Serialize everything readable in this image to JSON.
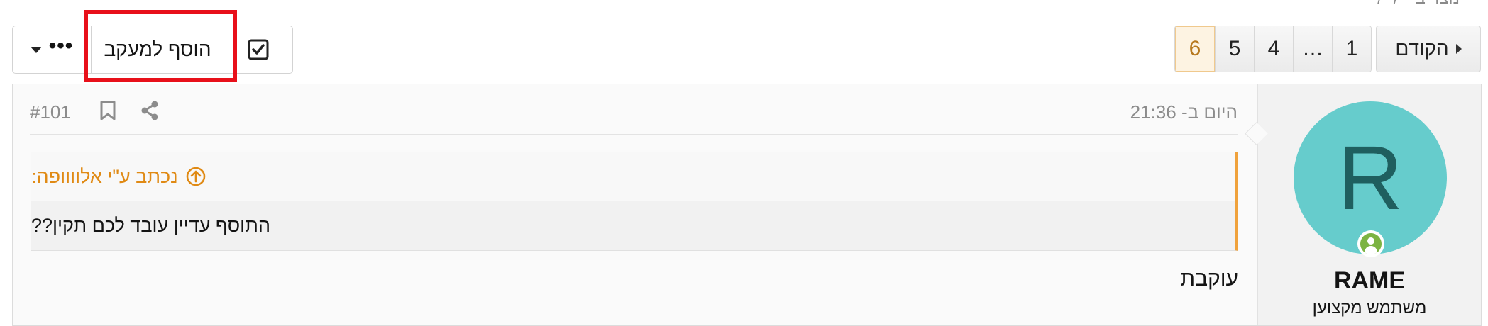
{
  "topmeta": {
    "text": "נוצר ב-··/··/·· · · ·"
  },
  "pagination": {
    "prev_label": "הקודם",
    "pages": [
      "1",
      "…",
      "4",
      "5",
      "6"
    ],
    "current_page": "6"
  },
  "thread_actions": {
    "watch_label": "הוסף למעקב",
    "more_label": "•••"
  },
  "post": {
    "date": "היום ב- 21:36",
    "number": "#101",
    "author": {
      "avatar_letter": "R",
      "name": "RAME",
      "title": "משתמש מקצוען"
    },
    "quote": {
      "author_line": "נכתב ע\"י אלוווופה:",
      "text": "התוסף עדיין עובד לכם תקין??"
    },
    "body": "עוקבת"
  },
  "colors": {
    "avatar_bg": "#66cccc",
    "quote_accent": "#f0a23c",
    "highlight": "#e8101a",
    "current_page_bg": "#fdf3e2"
  }
}
